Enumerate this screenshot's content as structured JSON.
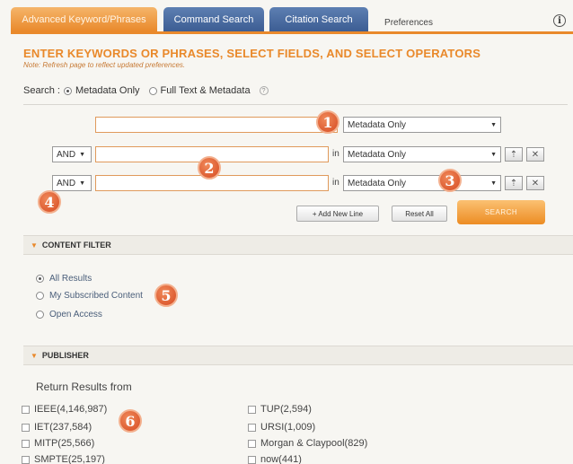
{
  "tabs": [
    {
      "label": "Advanced Keyword/Phrases"
    },
    {
      "label": "Command Search"
    },
    {
      "label": "Citation Search"
    },
    {
      "label": "Preferences"
    }
  ],
  "heading": "ENTER KEYWORDS OR PHRASES, SELECT FIELDS, AND SELECT OPERATORS",
  "note": "Note: Refresh page to reflect updated preferences.",
  "search_scope": {
    "label": "Search :",
    "options": [
      "Metadata Only",
      "Full Text & Metadata"
    ],
    "selected": "Metadata Only"
  },
  "rows": [
    {
      "operator": null,
      "value": "",
      "in_label": "",
      "field": "Metadata Only"
    },
    {
      "operator": "AND",
      "value": "",
      "in_label": "in",
      "field": "Metadata Only"
    },
    {
      "operator": "AND",
      "value": "",
      "in_label": "in",
      "field": "Metadata Only"
    }
  ],
  "buttons": {
    "add_new_line": "+ Add New Line",
    "reset_all": "Reset All",
    "search": "SEARCH"
  },
  "markers": [
    "1",
    "2",
    "3",
    "4",
    "5",
    "6"
  ],
  "content_filter": {
    "title": "CONTENT FILTER",
    "options": [
      "All Results",
      "My Subscribed Content",
      "Open Access"
    ],
    "selected": "All Results"
  },
  "publisher": {
    "title": "PUBLISHER",
    "return_label": "Return Results from",
    "left": [
      "IEEE(4,146,987)",
      "IET(237,584)",
      "MITP(25,566)",
      "SMPTE(25,197)"
    ],
    "right": [
      "TUP(2,594)",
      "URSI(1,009)",
      "Morgan & Claypool(829)",
      "now(441)"
    ]
  },
  "colors": {
    "accent": "#e9892b",
    "tab_blue": "#3c5d93",
    "marker": "#d64a22"
  }
}
